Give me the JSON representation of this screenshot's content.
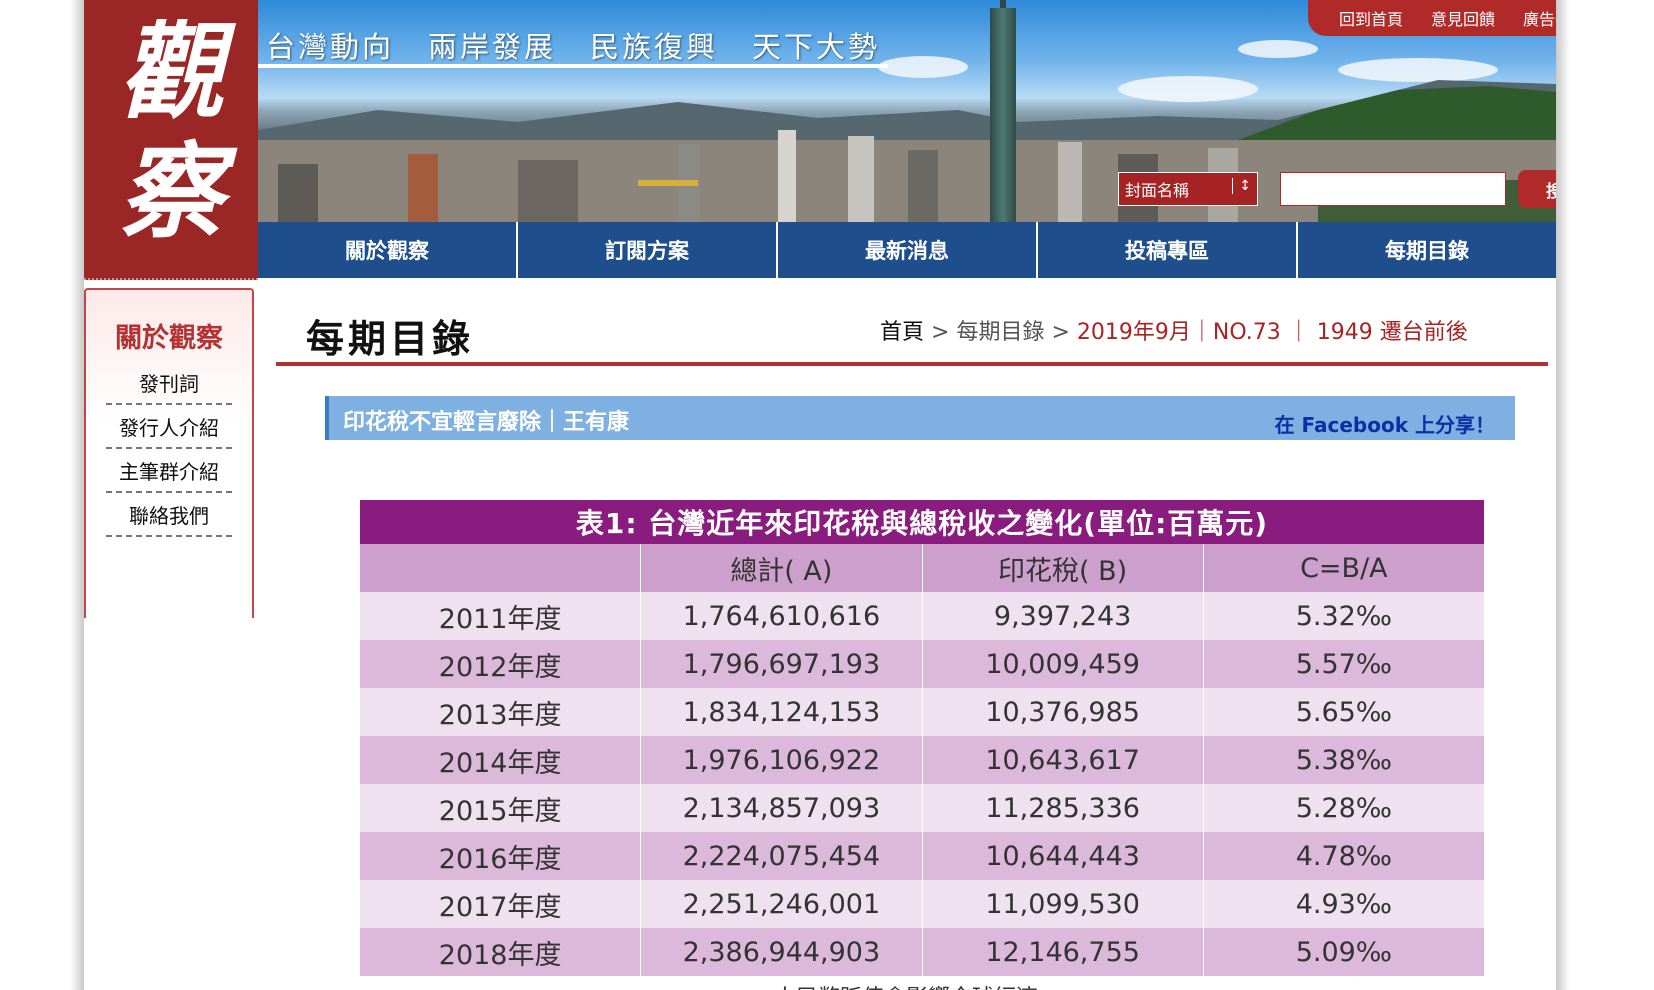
{
  "logo": {
    "char1": "觀",
    "char2": "察"
  },
  "top_nav": [
    "台灣動向",
    "兩岸發展",
    "民族復興",
    "天下大勢"
  ],
  "utility_links": [
    "回到首頁",
    "意見回饋",
    "廣告刊登"
  ],
  "search": {
    "select_value": "封面名稱",
    "button_label": "搜尋"
  },
  "main_nav": [
    "關於觀察",
    "訂閱方案",
    "最新消息",
    "投稿專區",
    "每期目錄"
  ],
  "sidebar": {
    "title": "關於觀察",
    "items": [
      "發刊詞",
      "發行人介紹",
      "主筆群介紹",
      "聯絡我們"
    ]
  },
  "page_title": "每期目錄",
  "breadcrumb": {
    "home": "首頁",
    "sep": ">",
    "section": "每期目錄",
    "issue": "2019年9月｜NO.73",
    "divider": "｜",
    "topic": "1949 遷台前後"
  },
  "article": {
    "title": "印花稅不宜輕言廢除｜王有康",
    "share": "在 Facebook 上分享！"
  },
  "chart_data": {
    "type": "table",
    "title": "表1: 台灣近年來印花稅與總稅收之變化(單位:百萬元)",
    "columns": [
      "",
      "總計( A)",
      "印花稅( B)",
      "C=B/A"
    ],
    "rows": [
      [
        "2011年度",
        "1,764,610,616",
        "9,397,243",
        "5.32‰"
      ],
      [
        "2012年度",
        "1,796,697,193",
        "10,009,459",
        "5.57‰"
      ],
      [
        "2013年度",
        "1,834,124,153",
        "10,376,985",
        "5.65‰"
      ],
      [
        "2014年度",
        "1,976,106,922",
        "10,643,617",
        "5.38‰"
      ],
      [
        "2015年度",
        "2,134,857,093",
        "11,285,336",
        "5.28‰"
      ],
      [
        "2016年度",
        "2,224,075,454",
        "10,644,443",
        "4.78‰"
      ],
      [
        "2017年度",
        "2,251,246,001",
        "11,099,530",
        "4.93‰"
      ],
      [
        "2018年度",
        "2,386,944,903",
        "12,146,755",
        "5.09‰"
      ]
    ]
  },
  "caption": "人民幣貶值會影響全球經濟。"
}
